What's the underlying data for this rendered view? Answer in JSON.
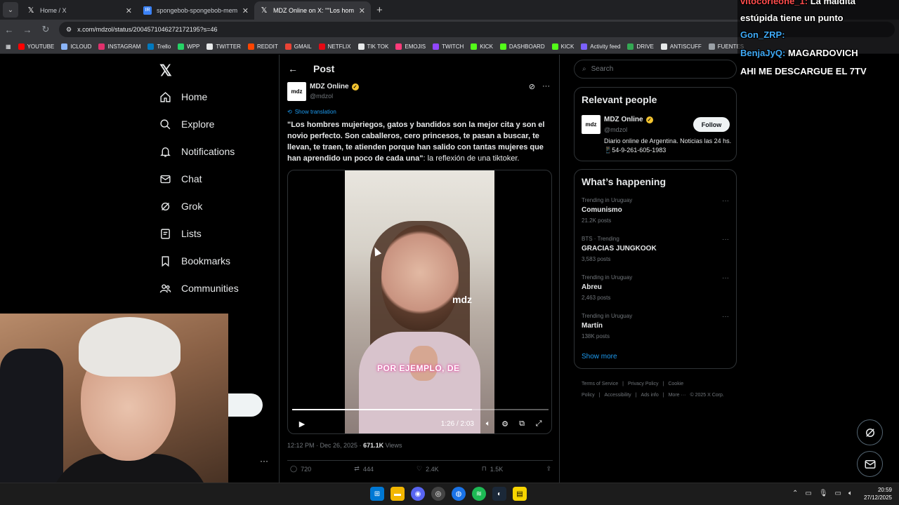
{
  "browser": {
    "tabs": [
      {
        "title": "Home / X",
        "icon": "x-logo-icon",
        "active": false
      },
      {
        "title": "spongebob-spongebob-meme",
        "icon": "image-resizer-icon",
        "active": false
      },
      {
        "title": "MDZ Online on X: \"\"Los hombr",
        "icon": "x-logo-icon",
        "active": true
      }
    ],
    "url": "x.com/mdzol/status/2004571046272172195?s=46",
    "bookmarks": [
      {
        "label": "YOUTUBE",
        "color": "#ff0000"
      },
      {
        "label": "ICLOUD",
        "color": "#8ab4f8"
      },
      {
        "label": "INSTAGRAM",
        "color": "#e1306c"
      },
      {
        "label": "Trello",
        "color": "#0079bf"
      },
      {
        "label": "WPP",
        "color": "#25d366"
      },
      {
        "label": "TWITTER",
        "color": "#e7e9ea"
      },
      {
        "label": "REDDIT",
        "color": "#ff4500"
      },
      {
        "label": "GMAIL",
        "color": "#ea4335"
      },
      {
        "label": "NETFLIX",
        "color": "#e50914"
      },
      {
        "label": "TIK TOK",
        "color": "#e7e9ea"
      },
      {
        "label": "EMOJIS",
        "color": "#ff3b7a"
      },
      {
        "label": "TWITCH",
        "color": "#9146ff"
      },
      {
        "label": "KICK",
        "color": "#53fc18"
      },
      {
        "label": "DASHBOARD",
        "color": "#53fc18"
      },
      {
        "label": "KICK",
        "color": "#53fc18"
      },
      {
        "label": "Activity feed",
        "color": "#7b61ff"
      },
      {
        "label": "DRIVE",
        "color": "#34a853"
      },
      {
        "label": "ANTISCUFF",
        "color": "#e7e9ea"
      },
      {
        "label": "FUENTES",
        "color": "#9aa0a6"
      }
    ]
  },
  "nav": {
    "items": [
      {
        "label": "Home",
        "icon": "home-icon"
      },
      {
        "label": "Explore",
        "icon": "search-icon"
      },
      {
        "label": "Notifications",
        "icon": "bell-icon"
      },
      {
        "label": "Chat",
        "icon": "mail-icon"
      },
      {
        "label": "Grok",
        "icon": "grok-icon"
      },
      {
        "label": "Lists",
        "icon": "list-icon"
      },
      {
        "label": "Bookmarks",
        "icon": "bookmark-icon"
      },
      {
        "label": "Communities",
        "icon": "people-icon"
      }
    ]
  },
  "post": {
    "header": "Post",
    "author_name": "MDZ Online",
    "author_handle": "@mdzol",
    "logo_text": "mdz",
    "show_translation": "Show translation",
    "text_bold": "\"Los hombres mujeriegos, gatos y bandidos son la mejor cita y son el novio perfecto. Son caballeros, cero princesos, te pasan a buscar, te llevan, te traen, te atienden porque han salido con tantas mujeres que han aprendido un poco de cada una\"",
    "text_rest": ": la reflexión de una tiktoker.",
    "video": {
      "watermark": "mdz",
      "caption": "POR EJEMPLO, DE",
      "time": "1:26 / 2:03",
      "progress": 0.7
    },
    "timestamp": "12:12 PM · Dec 26, 2025 · ",
    "views_count": "671.1K",
    "views_label": " Views",
    "replies": "720",
    "reposts": "444",
    "likes": "2.4K",
    "bookmarks": "1.5K"
  },
  "sidebar": {
    "search_placeholder": "Search",
    "relevant_title": "Relevant people",
    "person": {
      "name": "MDZ Online",
      "handle": "@mdzol",
      "bio": "Diario online de Argentina. Noticias las 24 hs. 📱54-9-261-605-1983",
      "follow": "Follow",
      "logo_text": "mdz"
    },
    "happening_title": "What’s happening",
    "trends": [
      {
        "context": "Trending in Uruguay",
        "name": "Comunismo",
        "count": "21.2K posts"
      },
      {
        "context": "BTS · Trending",
        "name": "GRACIAS JUNGKOOK",
        "count": "3,583 posts"
      },
      {
        "context": "Trending in Uruguay",
        "name": "Abreu",
        "count": "2,463 posts"
      },
      {
        "context": "Trending in Uruguay",
        "name": "Martín",
        "count": "138K posts"
      }
    ],
    "show_more": "Show more",
    "footer": [
      "Terms of Service",
      "|",
      "Privacy Policy",
      "|",
      "Cookie Policy",
      "|",
      "Accessibility",
      "|",
      "Ads info",
      "|",
      "More ···",
      "© 2025 X Corp."
    ]
  },
  "overlay": {
    "chat": [
      {
        "user": "vitocorleone_1:",
        "text": "La maldita",
        "user_color": "#ff4d4d"
      },
      {
        "user": "",
        "text": "estúpida tiene un punto",
        "user_color": "#ffffff"
      },
      {
        "user": "Gon_ZRP:",
        "text": "",
        "user_color": "#3fa9f5"
      },
      {
        "user": "BenjaJyQ:",
        "text": "MAGARDOVICH",
        "user_color": "#3fa9f5"
      },
      {
        "user": "",
        "text": "AHI ME DESCARGUE EL 7TV",
        "user_color": "#ffffff"
      }
    ]
  },
  "taskbar": {
    "time": "20:59",
    "date": "27/12/2025"
  }
}
